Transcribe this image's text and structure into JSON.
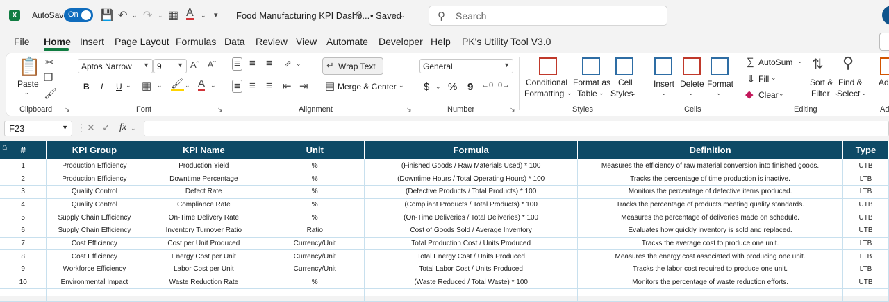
{
  "titlebar": {
    "logo_letter": "X",
    "autosave_label": "AutoSave",
    "autosave_state": "On",
    "doc_title": "Food Manufacturing KPI Dashb...",
    "saved_status": "• Saved",
    "search_placeholder": "Search"
  },
  "menu": [
    "File",
    "Home",
    "Insert",
    "Page Layout",
    "Formulas",
    "Data",
    "Review",
    "View",
    "Automate",
    "Developer",
    "Help",
    "PK's Utility Tool V3.0"
  ],
  "ribbon": {
    "clipboard": {
      "paste": "Paste",
      "label": "Clipboard"
    },
    "font": {
      "name": "Aptos Narrow",
      "size": "9",
      "bold": "B",
      "italic": "I",
      "underline": "U",
      "label": "Font"
    },
    "alignment": {
      "wrap_text": "Wrap Text",
      "merge_center": "Merge & Center",
      "label": "Alignment"
    },
    "number": {
      "format": "General",
      "currency": "$",
      "percent": "%",
      "comma": "9",
      "label": "Number"
    },
    "styles": {
      "conditional": "Conditional",
      "formatting": "Formatting",
      "format_as": "Format as",
      "table": "Table",
      "cell": "Cell",
      "cell_styles": "Styles",
      "label": "Styles"
    },
    "cells": {
      "insert": "Insert",
      "delete": "Delete",
      "format": "Format",
      "label": "Cells"
    },
    "editing": {
      "autosum": "AutoSum",
      "fill": "Fill",
      "clear": "Clear",
      "sort": "Sort &",
      "filter": "Filter",
      "find": "Find &",
      "select": "Select",
      "label": "Editing"
    },
    "addins_cut": "Add",
    "addins_label_cut": "Ad"
  },
  "formula_bar": {
    "cell_ref": "F23",
    "fx": "fx",
    "value": ""
  },
  "table": {
    "headers": [
      "#",
      "KPI Group",
      "KPI Name",
      "Unit",
      "Formula",
      "Definition",
      "Type"
    ],
    "rows": [
      [
        "1",
        "Production Efficiency",
        "Production Yield",
        "%",
        "(Finished Goods / Raw Materials Used) * 100",
        "Measures the efficiency of raw material conversion into finished goods.",
        "UTB"
      ],
      [
        "2",
        "Production Efficiency",
        "Downtime Percentage",
        "%",
        "(Downtime Hours / Total Operating Hours) * 100",
        "Tracks the percentage of time production is inactive.",
        "LTB"
      ],
      [
        "3",
        "Quality Control",
        "Defect Rate",
        "%",
        "(Defective Products / Total Products) * 100",
        "Monitors the percentage of defective items produced.",
        "LTB"
      ],
      [
        "4",
        "Quality Control",
        "Compliance Rate",
        "%",
        "(Compliant Products / Total Products) * 100",
        "Tracks the percentage of products meeting quality standards.",
        "UTB"
      ],
      [
        "5",
        "Supply Chain Efficiency",
        "On-Time Delivery Rate",
        "%",
        "(On-Time Deliveries / Total Deliveries) * 100",
        "Measures the percentage of deliveries made on schedule.",
        "UTB"
      ],
      [
        "6",
        "Supply Chain Efficiency",
        "Inventory Turnover Ratio",
        "Ratio",
        "Cost of Goods Sold / Average Inventory",
        "Evaluates how quickly inventory is sold and replaced.",
        "UTB"
      ],
      [
        "7",
        "Cost Efficiency",
        "Cost per Unit Produced",
        "Currency/Unit",
        "Total Production Cost / Units Produced",
        "Tracks the average cost to produce one unit.",
        "LTB"
      ],
      [
        "8",
        "Cost Efficiency",
        "Energy Cost per Unit",
        "Currency/Unit",
        "Total Energy Cost / Units Produced",
        "Measures the energy cost associated with producing one unit.",
        "LTB"
      ],
      [
        "9",
        "Workforce Efficiency",
        "Labor Cost per Unit",
        "Currency/Unit",
        "Total Labor Cost / Units Produced",
        "Tracks the labor cost required to produce one unit.",
        "LTB"
      ],
      [
        "10",
        "Environmental Impact",
        "Waste Reduction Rate",
        "%",
        "(Waste Reduced / Total Waste) * 100",
        "Monitors the percentage of waste reduction efforts.",
        "UTB"
      ],
      [
        "",
        "",
        "",
        "",
        "",
        "",
        ""
      ]
    ]
  }
}
